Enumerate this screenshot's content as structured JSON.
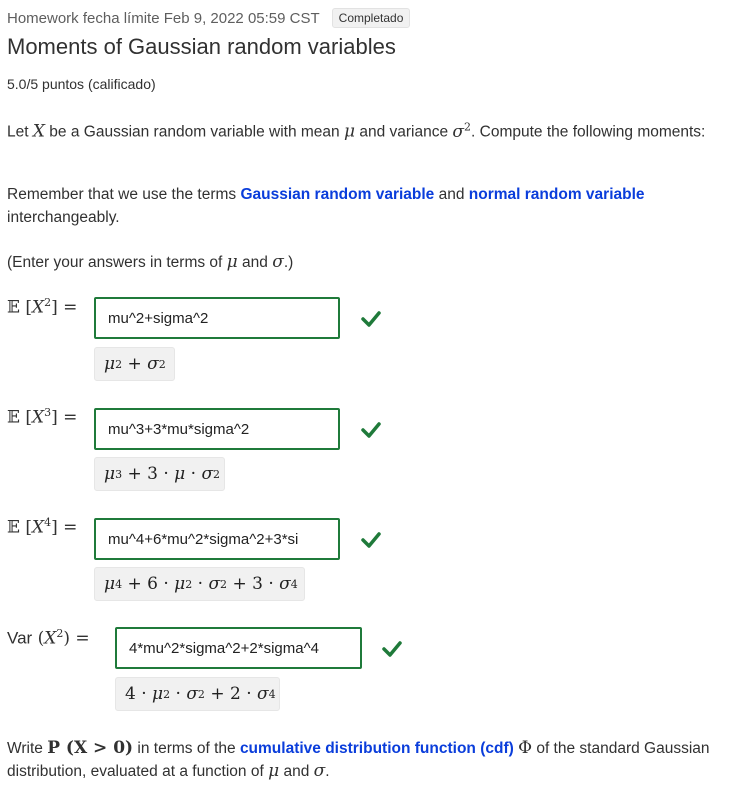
{
  "header": {
    "due": "Homework fecha límite Feb 9, 2022 05:59 CST",
    "status_badge": "Completado",
    "title": "Moments of Gaussian random variables",
    "score": "5.0/5 puntos (calificado)"
  },
  "intro": {
    "p1_a": "Let",
    "p1_X": "X",
    "p1_b": "be a Gaussian random variable with mean",
    "p1_mu": "μ",
    "p1_c": "and variance",
    "p1_sigma": "σ",
    "p1_d": ". Compute the following moments:",
    "p2_a": "Remember that we use the terms",
    "p2_link1": "Gaussian random variable",
    "p2_b": "and",
    "p2_link2": "normal random variable",
    "p2_c": "interchangeably.",
    "p3_a": "(Enter your answers in terms of",
    "p3_mu": "μ",
    "p3_b": "and",
    "p3_sigma": "σ",
    "p3_c": ".)"
  },
  "answers": [
    {
      "label_prefix": "𝔼",
      "label_exp": "2",
      "input_value": "mu^2+sigma^2",
      "status": "correct"
    },
    {
      "label_prefix": "𝔼",
      "label_exp": "3",
      "input_value": "mu^3+3*mu*sigma^2",
      "status": "correct"
    },
    {
      "label_prefix": "𝔼",
      "label_exp": "4",
      "input_value": "mu^4+6*mu^2*sigma^2+3*si",
      "status": "correct"
    },
    {
      "label_prefix": "Var",
      "label_exp": "2",
      "input_value": "4*mu^2*sigma^2+2*sigma^4",
      "status": "correct"
    }
  ],
  "footer": {
    "a": "Write",
    "math": "P (X > 0)",
    "b": "in terms of the",
    "link": "cumulative distribution function (cdf)",
    "phi": "Φ",
    "c": "of the standard Gaussian distribution, evaluated at a function of",
    "mu": "μ",
    "d": "and",
    "sigma": "σ",
    "e": "."
  },
  "colors": {
    "correct": "#1f7a3a",
    "link": "#0a3ddb"
  }
}
